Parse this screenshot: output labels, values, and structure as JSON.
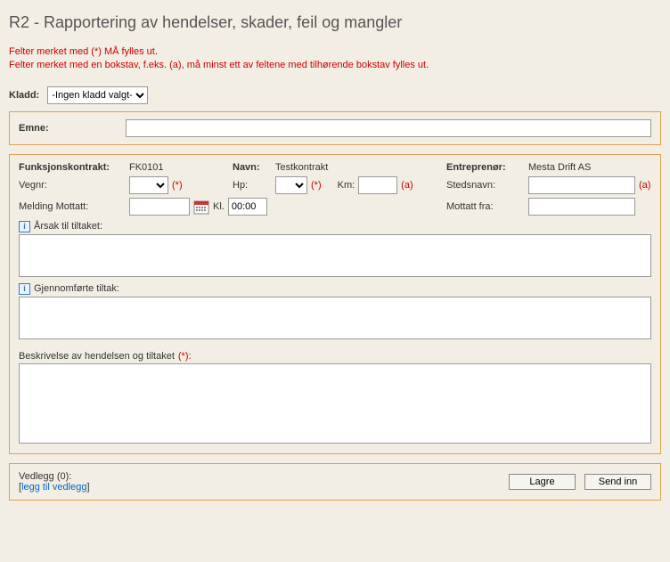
{
  "title": "R2 - Rapportering av hendelser, skader, feil og mangler",
  "notes": {
    "line1": "Felter merket med (*) MÅ fylles ut.",
    "line2": "Felter merket med en bokstav, f.eks. (a), må minst ett av feltene med tilhørende bokstav fylles ut."
  },
  "kladd": {
    "label": "Kladd:",
    "selected": "-Ingen kladd valgt-"
  },
  "emne": {
    "label": "Emne:",
    "value": ""
  },
  "contract": {
    "funksjon_lbl": "Funksjonskontrakt:",
    "funksjon_val": "FK0101",
    "navn_lbl": "Navn:",
    "navn_val": "Testkontrakt",
    "entre_lbl": "Entreprenør:",
    "entre_val": "Mesta Drift AS"
  },
  "loc": {
    "vegnr_lbl": "Vegnr:",
    "hp_lbl": "Hp:",
    "km_lbl": "Km:",
    "stedsnavn_lbl": "Stedsnavn:",
    "stedsnavn_val": ""
  },
  "markers": {
    "star": "(*)",
    "a": "(a)"
  },
  "melding": {
    "mottatt_lbl": "Melding Mottatt:",
    "mottatt_val": "",
    "kl_lbl": "Kl.",
    "kl_val": "00:00",
    "fra_lbl": "Mottatt fra:",
    "fra_val": ""
  },
  "sections": {
    "arsak_lbl": "Årsak til tiltaket:",
    "gjennom_lbl": "Gjennomførte tiltak:",
    "beskriv_lbl": "Beskrivelse av hendelsen og tiltaket",
    "beskriv_req": "(*):"
  },
  "vedlegg": {
    "label": "Vedlegg (0):",
    "link": "legg til vedlegg"
  },
  "buttons": {
    "lagre": "Lagre",
    "send": "Send inn"
  }
}
